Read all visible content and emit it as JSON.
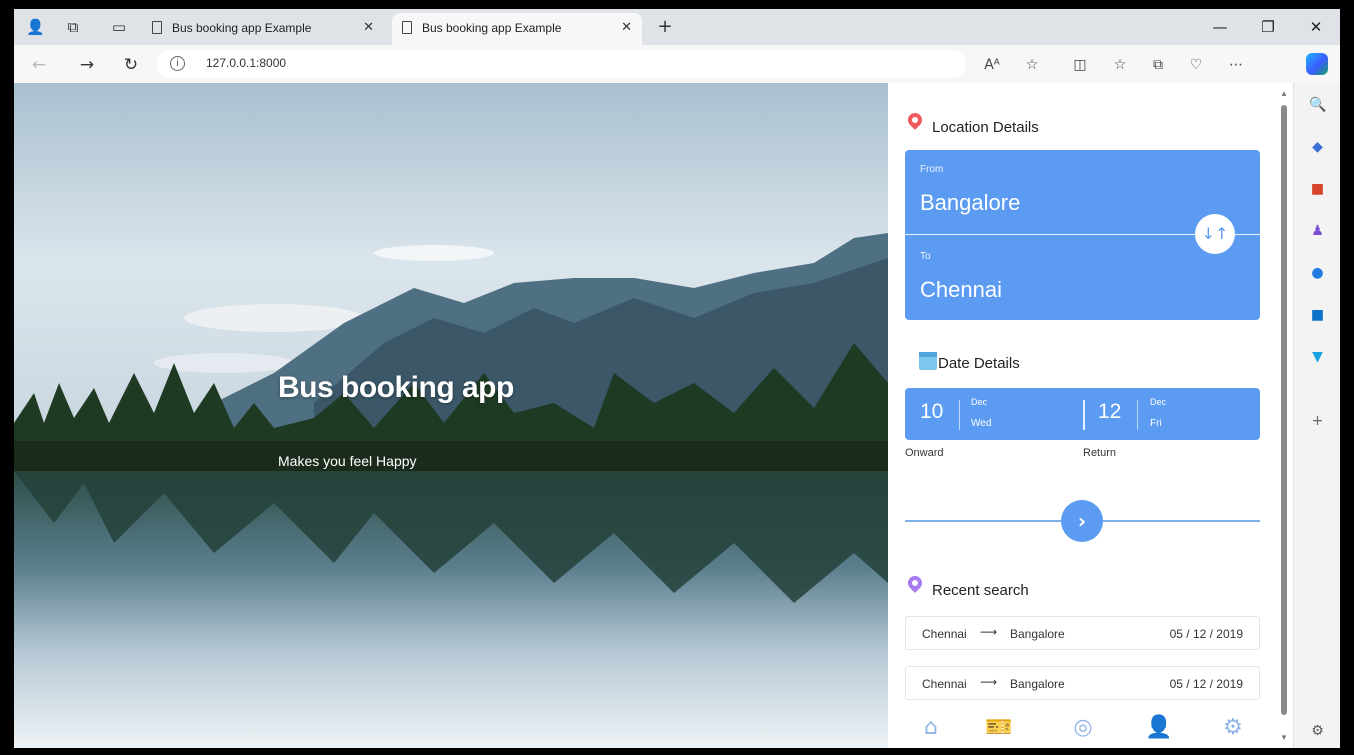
{
  "browser": {
    "tabs": [
      {
        "title": "Bus booking app Example",
        "active": false
      },
      {
        "title": "Bus booking app Example",
        "active": true
      }
    ],
    "new_tab": "+",
    "url": "127.0.0.1:8000",
    "window_controls": {
      "minimize": "—",
      "restore": "❐",
      "close": "✕"
    }
  },
  "hero": {
    "title": "Bus booking app",
    "subtitle": "Makes you feel Happy"
  },
  "location": {
    "title": "Location Details",
    "from_label": "From",
    "from_city": "Bangalore",
    "to_label": "To",
    "to_city": "Chennai",
    "swap_icon": "↓↑"
  },
  "dates": {
    "title": "Date Details",
    "onward": {
      "day": "10",
      "month": "Dec",
      "weekday": "Wed",
      "label": "Onward"
    },
    "return": {
      "day": "12",
      "month": "Dec",
      "weekday": "Fri",
      "label": "Return"
    }
  },
  "go_icon": "›",
  "recent": {
    "title": "Recent search",
    "items": [
      {
        "from": "Chennai",
        "arrow": "⟶",
        "to": "Bangalore",
        "date": "05 / 12 / 2019"
      },
      {
        "from": "Chennai",
        "arrow": "⟶",
        "to": "Bangalore",
        "date": "05 / 12 / 2019"
      }
    ]
  },
  "colors": {
    "accent": "#5b9bf2",
    "pin_red": "#f05a5a",
    "pin_purple": "#a77cf0"
  }
}
